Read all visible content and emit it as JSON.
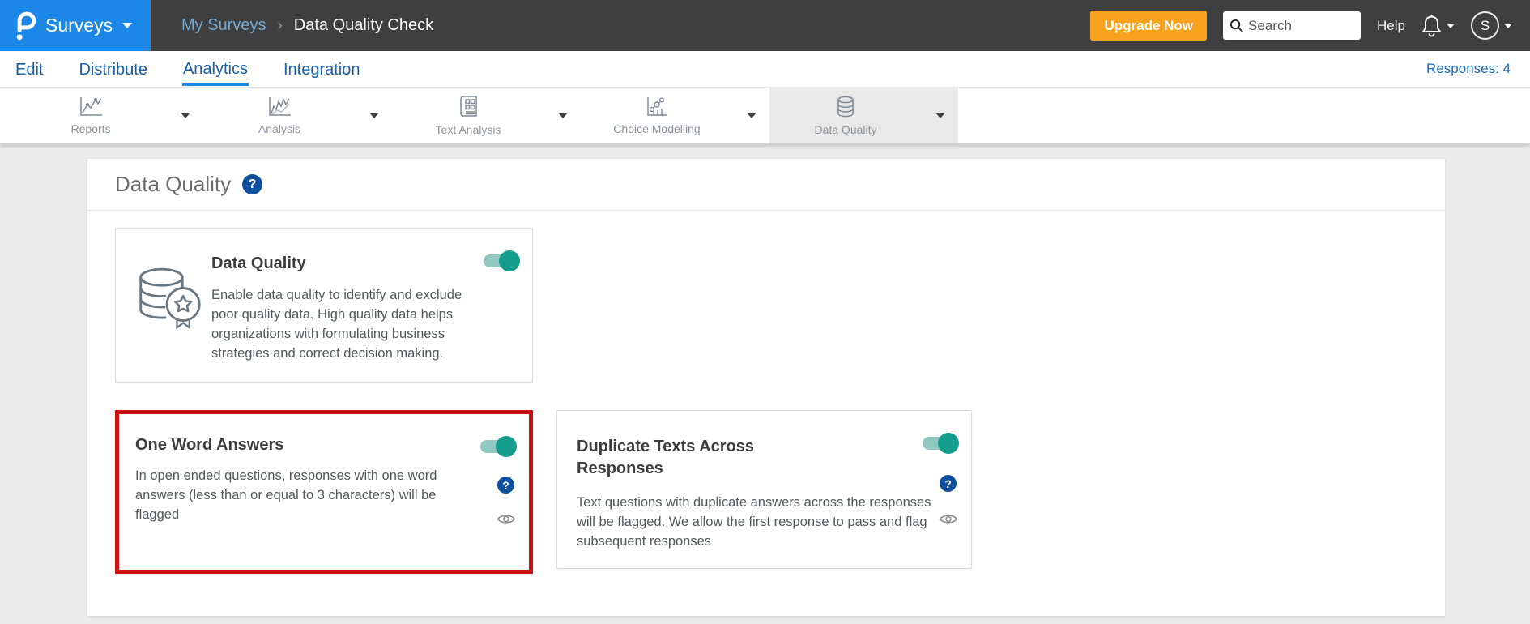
{
  "colors": {
    "brand_blue": "#1b87e6",
    "header_dark": "#3f3f3f",
    "accent_teal": "#149c8c",
    "accent_teal_track": "#8fc9c2",
    "upgrade_orange": "#f9a21e",
    "highlight_red": "#cc1111",
    "link_blue": "#1a5fa8",
    "help_blue": "#0e4f9e",
    "page_bg": "#ebebeb"
  },
  "header": {
    "product": "Surveys",
    "breadcrumb": {
      "parent": "My Surveys",
      "separator": "›",
      "current": "Data Quality Check"
    },
    "upgrade_label": "Upgrade Now",
    "search_placeholder": "Search",
    "help_label": "Help",
    "avatar_initial": "S"
  },
  "nav": {
    "items": [
      {
        "label": "Edit"
      },
      {
        "label": "Distribute"
      },
      {
        "label": "Analytics",
        "active": true
      },
      {
        "label": "Integration"
      }
    ],
    "responses_label": "Responses: 4"
  },
  "toolbar": {
    "tabs": [
      {
        "label": "Reports",
        "icon": "line-chart-icon"
      },
      {
        "label": "Analysis",
        "icon": "trend-chart-icon"
      },
      {
        "label": "Text Analysis",
        "icon": "document-grid-icon"
      },
      {
        "label": "Choice Modelling",
        "icon": "bubble-chart-icon"
      },
      {
        "label": "Data Quality",
        "icon": "database-icon",
        "active": true
      }
    ]
  },
  "page": {
    "title": "Data Quality"
  },
  "cards": {
    "main": {
      "title": "Data Quality",
      "description": "Enable data quality to identify and exclude poor quality data. High quality data helps organizations with formulating business strategies and correct decision making.",
      "toggle_state": "on"
    },
    "one_word": {
      "title": "One Word Answers",
      "description": "In open ended questions, responses with one word answers (less than or equal to 3 characters) will be flagged",
      "toggle_state": "on",
      "highlighted": true
    },
    "duplicate": {
      "title": "Duplicate Texts Across Responses",
      "description": "Text questions with duplicate answers across the responses will be flagged. We allow the first response to pass and flag subsequent responses",
      "toggle_state": "on"
    }
  }
}
